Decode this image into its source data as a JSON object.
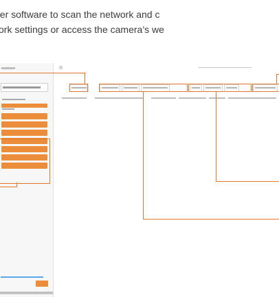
{
  "intro": {
    "line1": "der software to scan the network and c",
    "line2": "ork settings or access the camera’s we"
  },
  "colors": {
    "accent_orange": "#e2762b",
    "button_orange": "#ec8d3c",
    "slider_blue": "#5aa7e6"
  },
  "figure": {
    "sidebar_buttons": 7,
    "table_columns": 8,
    "callouts": 6
  }
}
